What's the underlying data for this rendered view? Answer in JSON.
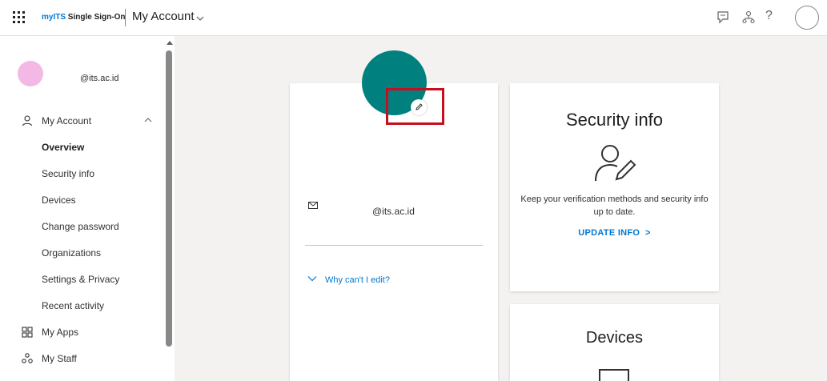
{
  "header": {
    "brand_prefix": "myITS",
    "brand_suffix": " Single Sign-On",
    "app_title": "My Account",
    "help_label": "?"
  },
  "sidebar": {
    "user_email": "@its.ac.id",
    "items": [
      {
        "label": "My Account",
        "icon": "person-icon",
        "type": "parent",
        "expanded": true
      },
      {
        "label": "Overview",
        "type": "child",
        "active": true
      },
      {
        "label": "Security info",
        "type": "child"
      },
      {
        "label": "Devices",
        "type": "child"
      },
      {
        "label": "Change password",
        "type": "child"
      },
      {
        "label": "Organizations",
        "type": "child"
      },
      {
        "label": "Settings & Privacy",
        "type": "child"
      },
      {
        "label": "Recent activity",
        "type": "child"
      },
      {
        "label": "My Apps",
        "icon": "apps-icon",
        "type": "parent"
      },
      {
        "label": "My Staff",
        "icon": "staff-icon",
        "type": "parent"
      }
    ]
  },
  "profile": {
    "email": "@its.ac.id",
    "why_cant_edit": "Why can't I edit?"
  },
  "security": {
    "title": "Security info",
    "description": "Keep your verification methods and security info up to date.",
    "link": "UPDATE INFO",
    "link_chevron": ">"
  },
  "devices": {
    "title": "Devices"
  },
  "colors": {
    "accent": "#0078d4",
    "avatar_teal": "#00817f",
    "side_avatar_pink": "#f4b8e4",
    "highlight_red": "#c50f1f"
  }
}
